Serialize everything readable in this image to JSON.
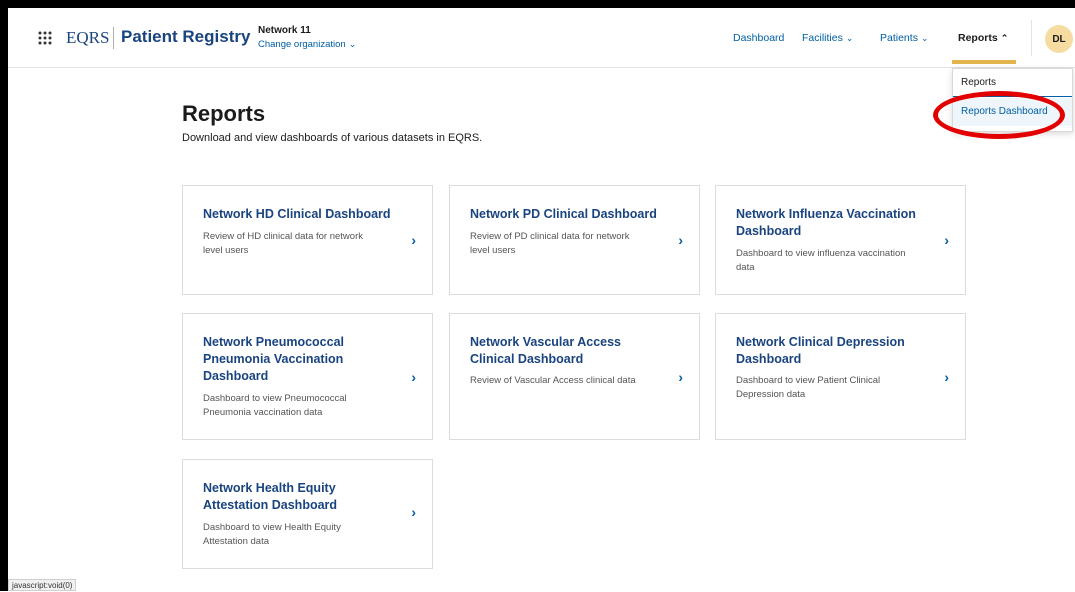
{
  "brand": {
    "eqrs": "EQRS",
    "registry": "Patient Registry"
  },
  "org": {
    "name": "Network 11",
    "change_label": "Change organization"
  },
  "nav": {
    "dashboard": "Dashboard",
    "facilities": "Facilities",
    "patients": "Patients",
    "reports": "Reports"
  },
  "user": {
    "initials": "DL"
  },
  "dropdown": {
    "items": [
      "Reports",
      "Reports Dashboard"
    ]
  },
  "page": {
    "title": "Reports",
    "subtitle": "Download and view dashboards of various datasets in EQRS."
  },
  "cards": [
    {
      "title": "Network HD Clinical Dashboard",
      "description": "Review of HD clinical data for network level users"
    },
    {
      "title": "Network PD Clinical Dashboard",
      "description": "Review of PD clinical data for network level users"
    },
    {
      "title": "Network Influenza Vaccination Dashboard",
      "description": "Dashboard to view influenza vaccination data"
    },
    {
      "title": "Network Pneumococcal Pneumonia Vaccination Dashboard",
      "description": "Dashboard to view Pneumococcal Pneumonia vaccination data"
    },
    {
      "title": "Network Vascular Access Clinical Dashboard",
      "description": "Review of Vascular Access clinical data"
    },
    {
      "title": "Network Clinical Depression Dashboard",
      "description": "Dashboard to view Patient Clinical Depression data"
    },
    {
      "title": "Network Health Equity Attestation Dashboard",
      "description": "Dashboard to view Health Equity Attestation data"
    }
  ],
  "status_bar": {
    "text": "javascript:void(0)"
  },
  "icons": {
    "apps": "grid-icon",
    "chevron": "chevron-down-icon",
    "chevron_up": "chevron-up-icon",
    "card_arrow": "chevron-right-icon"
  },
  "colors": {
    "link": "#005ea2",
    "brand": "#1a4480",
    "accent": "#e2b54f",
    "annotation": "#e30000"
  }
}
